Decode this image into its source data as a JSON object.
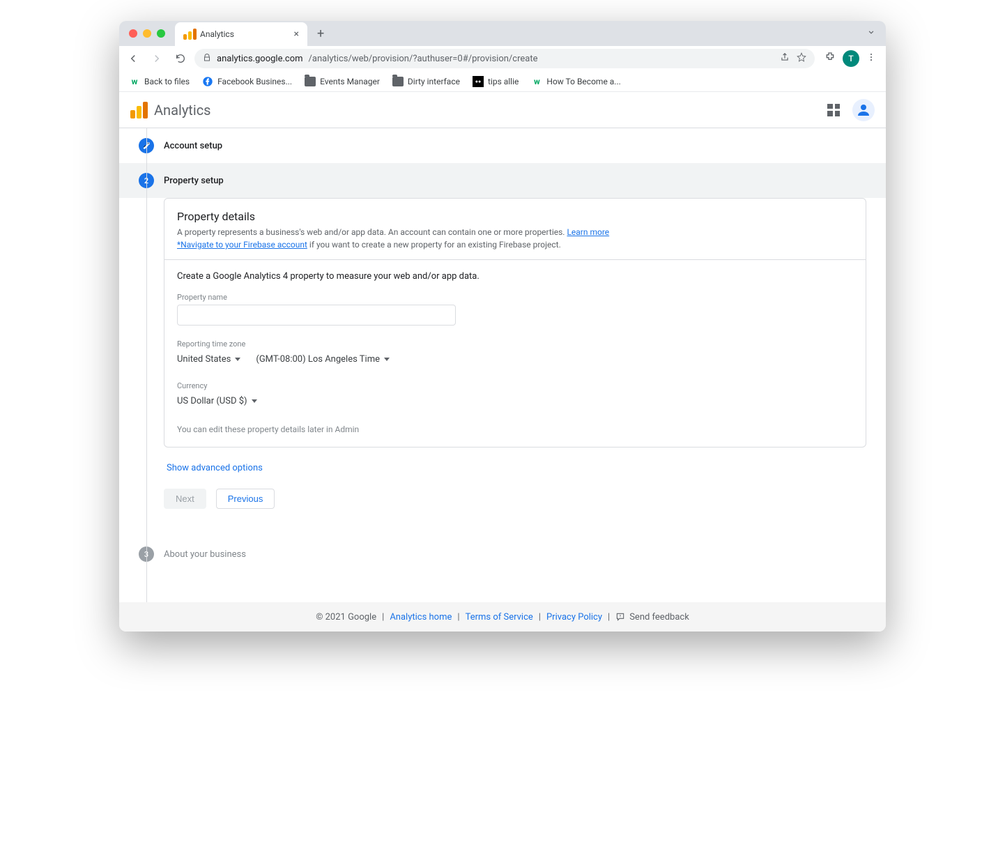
{
  "browser": {
    "tab_title": "Analytics",
    "url_domain": "analytics.google.com",
    "url_path": "/analytics/web/provision/?authuser=0#/provision/create",
    "avatar_letter": "T"
  },
  "bookmarks": [
    {
      "label": "Back to files"
    },
    {
      "label": "Facebook Busines..."
    },
    {
      "label": "Events Manager"
    },
    {
      "label": "Dirty interface"
    },
    {
      "label": "tips allie"
    },
    {
      "label": "How To Become a..."
    }
  ],
  "header": {
    "app_name": "Analytics"
  },
  "steps": {
    "s1_label": "Account setup",
    "s2_number": "2",
    "s2_label": "Property setup",
    "s3_number": "3",
    "s3_label": "About your business"
  },
  "card": {
    "title": "Property details",
    "desc_prefix": "A property represents a business's web and/or app data. An account can contain one or more properties. ",
    "learn_more": "Learn more",
    "firebase_link": "*Navigate to your Firebase account",
    "desc_suffix": " if you want to create a new property for an existing Firebase project.",
    "lead": "Create a Google Analytics 4 property to measure your web and/or app data.",
    "property_name_label": "Property name",
    "property_name_value": "",
    "timezone_label": "Reporting time zone",
    "timezone_country": "United States",
    "timezone_value": "(GMT-08:00) Los Angeles Time",
    "currency_label": "Currency",
    "currency_value": "US Dollar (USD $)",
    "hint": "You can edit these property details later in Admin"
  },
  "advanced_link": "Show advanced options",
  "buttons": {
    "next": "Next",
    "previous": "Previous"
  },
  "footer": {
    "copyright": "© 2021 Google",
    "analytics_home": "Analytics home",
    "terms": "Terms of Service",
    "privacy": "Privacy Policy",
    "feedback": "Send feedback"
  }
}
